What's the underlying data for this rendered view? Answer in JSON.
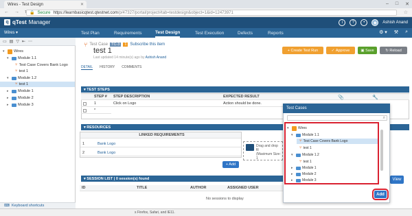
{
  "browser": {
    "tab_title": "Wires - Test Design",
    "secure_label": "Secure",
    "url_host": "https://learnbasicqtest.qtestnet.com",
    "url_path": "/p/47327/portal/project#tab=testdesign&object=1&id=12473971"
  },
  "app": {
    "logo_text": "qTest",
    "product": "Manager",
    "user_name": "Ashish Anand",
    "project": "Wires ▾",
    "nav_tabs": [
      "Test Plan",
      "Requirements",
      "Test Design",
      "Test Execution",
      "Defects",
      "Reports"
    ],
    "active_tab": "Test Design"
  },
  "left_tree": {
    "items": [
      {
        "label": "Wires",
        "type": "root",
        "depth": 0
      },
      {
        "label": "Module 1.1",
        "type": "folder",
        "depth": 1
      },
      {
        "label": "Test Case Covers Bank Logo",
        "type": "testcase",
        "depth": 2
      },
      {
        "label": "test 1",
        "type": "testcase",
        "depth": 2
      },
      {
        "label": "Module 1.2",
        "type": "folder",
        "depth": 1
      },
      {
        "label": "test 1",
        "type": "testcase",
        "depth": 2,
        "selected": true
      },
      {
        "label": "Module 1",
        "type": "folder",
        "depth": 1
      },
      {
        "label": "Module 2",
        "type": "folder",
        "depth": 1
      },
      {
        "label": "Module 3",
        "type": "folder",
        "depth": 1
      }
    ],
    "keyboard_shortcuts": "Keyboard shortcuts"
  },
  "test_case": {
    "kind_label": "Test Case",
    "id_badge": "TC-3",
    "count_badge": "1",
    "subscribe": "Subscribe this item",
    "title": "test 1",
    "updated": "Last updated 14 minute(s) ago by",
    "updated_by": "Ashish Anand",
    "tabs": [
      "DETAIL",
      "HISTORY",
      "COMMENTS"
    ],
    "buttons": {
      "create_test_run": "Create Test Run",
      "approve": "Approve",
      "save": "Save",
      "reload": "Reload"
    }
  },
  "test_steps": {
    "header": "TEST STEPS",
    "columns": [
      "STEP #",
      "STEP DESCRIPTION",
      "EXPECTED RESULT"
    ],
    "rows": [
      {
        "step": "1",
        "description": "Click on Logo",
        "expected": "Action should be done."
      }
    ]
  },
  "resources": {
    "header": "RESOURCES",
    "linked_header": "LINKED REQUIREMENTS",
    "rows": [
      {
        "num": "1",
        "name": "Bank Logo"
      },
      {
        "num": "2",
        "name": "Bank Logo"
      }
    ],
    "add_label": "+ Add",
    "drop_text_1": "Drag and drop fil",
    "drop_text_2": "(Maximum Size: 1"
  },
  "session_list": {
    "header": "SESSION LIST",
    "count": "0 session(s) found",
    "columns": [
      "ID",
      "TITLE",
      "AUTHOR",
      "ASSIGNED USER"
    ],
    "empty": "No sessions to display",
    "view_label": "View"
  },
  "modal": {
    "title": "Test Cases",
    "tree": [
      {
        "label": "Wires",
        "type": "root",
        "depth": 0
      },
      {
        "label": "Module 1.1",
        "type": "folder",
        "depth": 1
      },
      {
        "label": "Test Case Covers Bank Logo",
        "type": "testcase",
        "depth": 2,
        "selected": true
      },
      {
        "label": "test 1",
        "type": "testcase",
        "depth": 2
      },
      {
        "label": "Module 1.2",
        "type": "folder",
        "depth": 1
      },
      {
        "label": "test 1",
        "type": "testcase",
        "depth": 2
      },
      {
        "label": "Module 1",
        "type": "folder",
        "depth": 1
      },
      {
        "label": "Module 2",
        "type": "folder",
        "depth": 1
      },
      {
        "label": "Module 3",
        "type": "folder",
        "depth": 1
      }
    ],
    "add_label": "Add"
  },
  "status_bar": "s Firefox, Safari, and IE11.",
  "colors": {
    "header_dark": "#1f4f7a",
    "nav_blue": "#2b6596",
    "highlight_red": "#d9202f",
    "create_orange": "#f0a030",
    "save_green": "#5aa02c",
    "reload_gray": "#7a7f86"
  }
}
